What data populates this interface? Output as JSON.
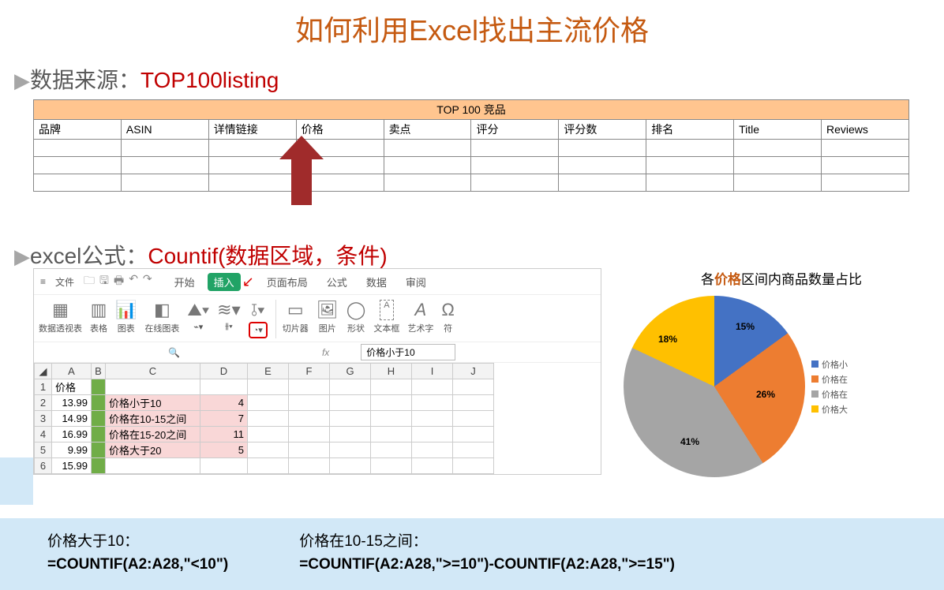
{
  "title": "如何利用Excel找出主流价格",
  "section1": {
    "label": "数据来源：",
    "value": "TOP100listing"
  },
  "top_table": {
    "header": "TOP 100 竞品",
    "cols": [
      "品牌",
      "ASIN",
      "详情链接",
      "价格",
      "卖点",
      "评分",
      "评分数",
      "排名",
      "Title",
      "Reviews"
    ]
  },
  "section2": {
    "label": "excel公式：",
    "value": "Countif(数据区域，条件)"
  },
  "excel": {
    "menu": {
      "file": "文件",
      "tabs": [
        "开始",
        "插入",
        "页面布局",
        "公式",
        "数据",
        "审阅"
      ],
      "active": "插入"
    },
    "ribbon": {
      "groups": [
        "数据透视表",
        "表格",
        "图表",
        "在线图表",
        "",
        "",
        "",
        "切片器",
        "图片",
        "形状",
        "文本框",
        "艺术字",
        "符"
      ],
      "icons": [
        "▦",
        "▥",
        "📊",
        "◧",
        "⛰",
        "≋",
        "⋮",
        "◔",
        "⫱",
        "▭",
        "🖼",
        "⬠",
        "A",
        "A",
        "符"
      ]
    },
    "fx": {
      "label": "fx",
      "value": "价格小于10"
    },
    "cols": [
      "",
      "A",
      "B",
      "C",
      "D",
      "E",
      "F",
      "G",
      "H",
      "I",
      "J"
    ],
    "rows": [
      {
        "n": "1",
        "A": "价格",
        "C": "",
        "D": ""
      },
      {
        "n": "2",
        "A": "13.99",
        "C": "价格小于10",
        "D": "4"
      },
      {
        "n": "3",
        "A": "14.99",
        "C": "价格在10-15之间",
        "D": "7"
      },
      {
        "n": "4",
        "A": "16.99",
        "C": "价格在15-20之间",
        "D": "11"
      },
      {
        "n": "5",
        "A": "9.99",
        "C": "价格大于20",
        "D": "5"
      },
      {
        "n": "6",
        "A": "15.99",
        "C": "",
        "D": ""
      }
    ]
  },
  "chart_data": {
    "type": "pie",
    "title_prefix": "各",
    "title_hl": "价格",
    "title_suffix": "区间内商品数量占比",
    "series": [
      {
        "name": "价格小",
        "value": 15,
        "color": "#4472c4"
      },
      {
        "name": "价格在",
        "value": 26,
        "color": "#ed7d31"
      },
      {
        "name": "价格在",
        "value": 41,
        "color": "#a5a5a5"
      },
      {
        "name": "价格大",
        "value": 18,
        "color": "#ffc000"
      }
    ],
    "labels": [
      "15%",
      "26%",
      "41%",
      "18%"
    ]
  },
  "formulas": {
    "left_title": "价格大于10：",
    "left_f": "=COUNTIF(A2:A28,\"<10\")",
    "right_title": "价格在10-15之间：",
    "right_f": "=COUNTIF(A2:A28,\">=10\")-COUNTIF(A2:A28,\">=15\")"
  }
}
